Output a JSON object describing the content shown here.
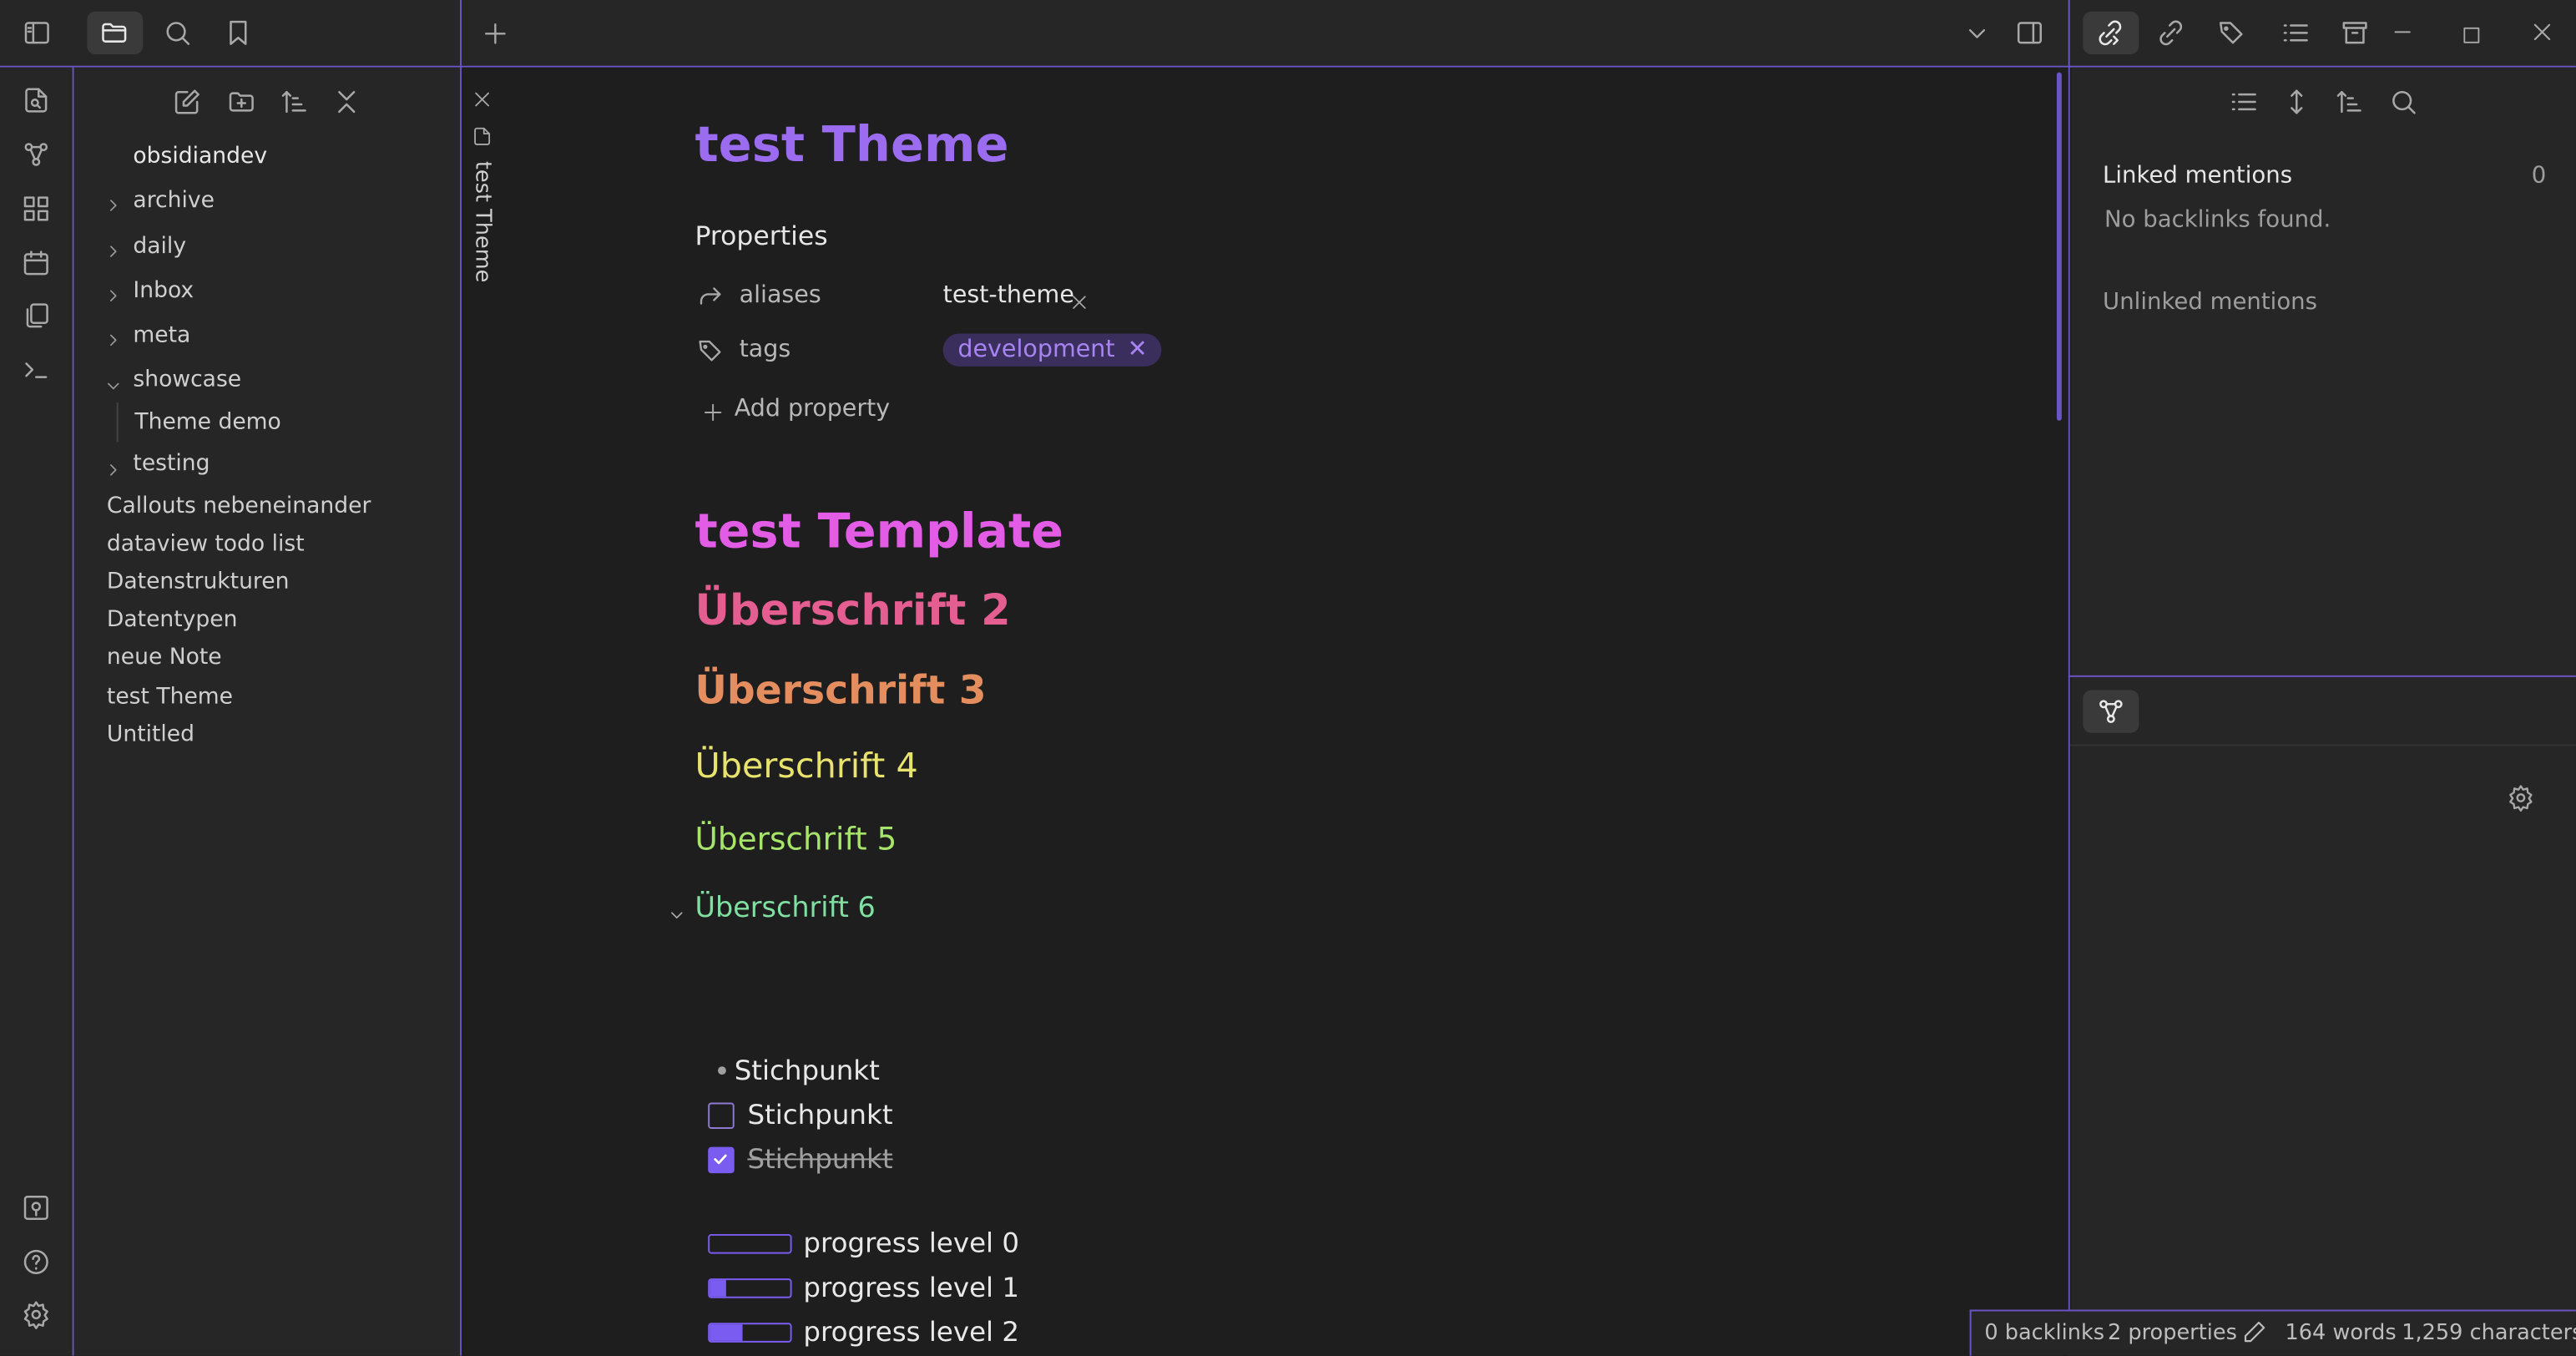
{
  "sidebar_tabs": {
    "toggle": "sidebar-toggle-icon",
    "files": "folder-icon",
    "search": "search-icon",
    "bookmarks": "bookmark-icon"
  },
  "tab_strip": {
    "new_tab_icon": "plus-icon",
    "vertical_tab_title": "test Theme"
  },
  "file_explorer": {
    "root": "obsidiandev",
    "folders": [
      "archive",
      "daily",
      "Inbox",
      "meta",
      "showcase",
      "testing"
    ],
    "showcase_children": [
      "Theme demo"
    ],
    "files": [
      "Callouts nebeneinander",
      "dataview todo list",
      "Datenstrukturen",
      "Datentypen",
      "neue Note",
      "test Theme",
      "Untitled"
    ]
  },
  "note": {
    "title": "test Theme",
    "properties_heading": "Properties",
    "properties": {
      "aliases_key": "aliases",
      "aliases_value": "test-theme",
      "tags_key": "tags",
      "tags_value": "development"
    },
    "add_property": "Add property",
    "headings": {
      "h1": "test Template",
      "h2": "Überschrift 2",
      "h3": "Überschrift 3",
      "h4": "Überschrift 4",
      "h5": "Überschrift 5",
      "h6": "Überschrift 6"
    },
    "bullet": "Stichpunkt",
    "task_open": "Stichpunkt",
    "task_done": "Stichpunkt",
    "progress": [
      {
        "label": "progress level 0",
        "value": 0
      },
      {
        "label": "progress level 1",
        "value": 0.2
      },
      {
        "label": "progress level 2",
        "value": 0.4
      }
    ]
  },
  "backlinks": {
    "linked_label": "Linked mentions",
    "linked_count": "0",
    "empty_text": "No backlinks found.",
    "unlinked_label": "Unlinked mentions"
  },
  "statusbar": {
    "backlinks": "0 backlinks",
    "properties": "2 properties",
    "words": "164 words",
    "characters": "1,259 characters"
  },
  "colors": {
    "accent": "#7a5cf0",
    "title": "#9b6cf0",
    "h1": "#e25ce6",
    "h2": "#e45e91",
    "h3": "#e48d5e",
    "h4": "#e8e36c",
    "h5": "#a7e56a",
    "h6": "#7fe0a1"
  }
}
